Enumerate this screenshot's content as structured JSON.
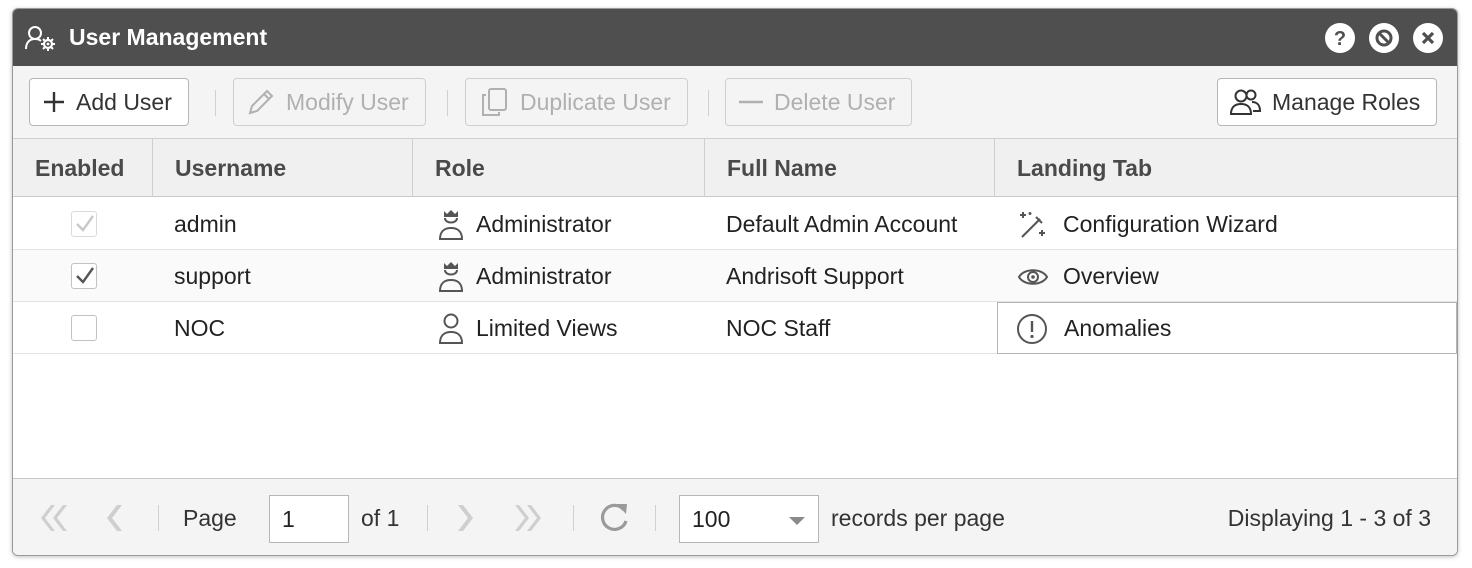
{
  "window": {
    "title": "User Management",
    "icons": [
      "users-settings-icon",
      "help-icon",
      "minimize-icon",
      "close-icon"
    ]
  },
  "toolbar": {
    "add_user": "Add User",
    "modify_user": "Modify User",
    "duplicate_user": "Duplicate User",
    "delete_user": "Delete User",
    "manage_roles": "Manage Roles"
  },
  "grid": {
    "columns": [
      "Enabled",
      "Username",
      "Role",
      "Full Name",
      "Landing Tab"
    ],
    "rows": [
      {
        "enabled": true,
        "enabled_locked": true,
        "username": "admin",
        "role": "Administrator",
        "role_icon": "administrator-icon",
        "full_name": "Default Admin Account",
        "landing_tab": "Configuration Wizard",
        "landing_icon": "magic-wand-icon"
      },
      {
        "enabled": true,
        "enabled_locked": false,
        "username": "support",
        "role": "Administrator",
        "role_icon": "administrator-icon",
        "full_name": "Andrisoft Support",
        "landing_tab": "Overview",
        "landing_icon": "eye-icon"
      },
      {
        "enabled": false,
        "enabled_locked": false,
        "username": "NOC",
        "role": "Limited Views",
        "role_icon": "user-icon",
        "full_name": "NOC Staff",
        "landing_tab": "Anomalies",
        "landing_icon": "exclamation-circle-icon"
      }
    ]
  },
  "pager": {
    "page_label": "Page",
    "page_value": "1",
    "of_label": "of 1",
    "page_size": "100",
    "records_label": "records per page",
    "displaying": "Displaying 1 - 3 of 3"
  },
  "colors": {
    "titlebar": "#4f4f4f",
    "toolbar_bg": "#f4f4f4",
    "header_bg": "#f0f0f0",
    "disabled_text": "#b0b0b0"
  }
}
